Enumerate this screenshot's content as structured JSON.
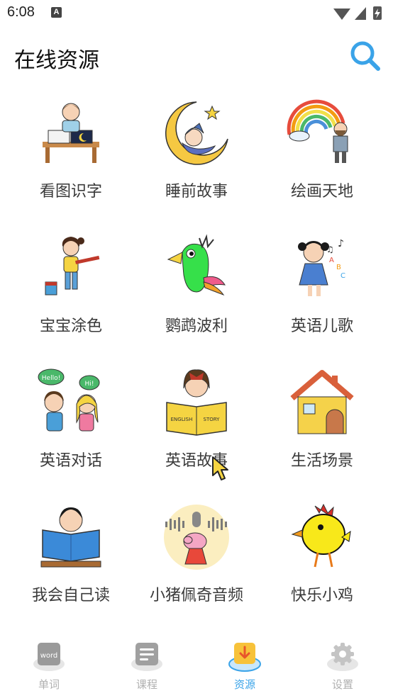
{
  "status_bar": {
    "time": "6:08",
    "notif_letter": "A"
  },
  "header": {
    "title": "在线资源"
  },
  "items": [
    {
      "label": "看图识字",
      "icon": "kid-reading-desk-icon"
    },
    {
      "label": "睡前故事",
      "icon": "moon-sleeping-baby-icon"
    },
    {
      "label": "绘画天地",
      "icon": "rainbow-painter-icon"
    },
    {
      "label": "宝宝涂色",
      "icon": "girl-painting-icon"
    },
    {
      "label": "鹦鹉波利",
      "icon": "parrot-icon"
    },
    {
      "label": "英语儿歌",
      "icon": "singing-girl-icon"
    },
    {
      "label": "英语对话",
      "icon": "kids-talking-icon"
    },
    {
      "label": "英语故事",
      "icon": "girl-story-book-icon",
      "book_left": "ENGLISH",
      "book_right": "STORY"
    },
    {
      "label": "生活场景",
      "icon": "house-icon"
    },
    {
      "label": "我会自己读",
      "icon": "boy-reading-book-icon"
    },
    {
      "label": "小猪佩奇音频",
      "icon": "peppa-audio-icon"
    },
    {
      "label": "快乐小鸡",
      "icon": "yellow-chick-icon"
    }
  ],
  "bubbles": {
    "hello": "Hello!",
    "hi": "Hi!"
  },
  "tabs": [
    {
      "label": "单词",
      "word": "word",
      "active": false
    },
    {
      "label": "课程",
      "active": false
    },
    {
      "label": "资源",
      "active": true
    },
    {
      "label": "设置",
      "active": false
    }
  ],
  "colors": {
    "accent": "#3aa3e8",
    "tab_inactive": "#b0b0b0"
  }
}
